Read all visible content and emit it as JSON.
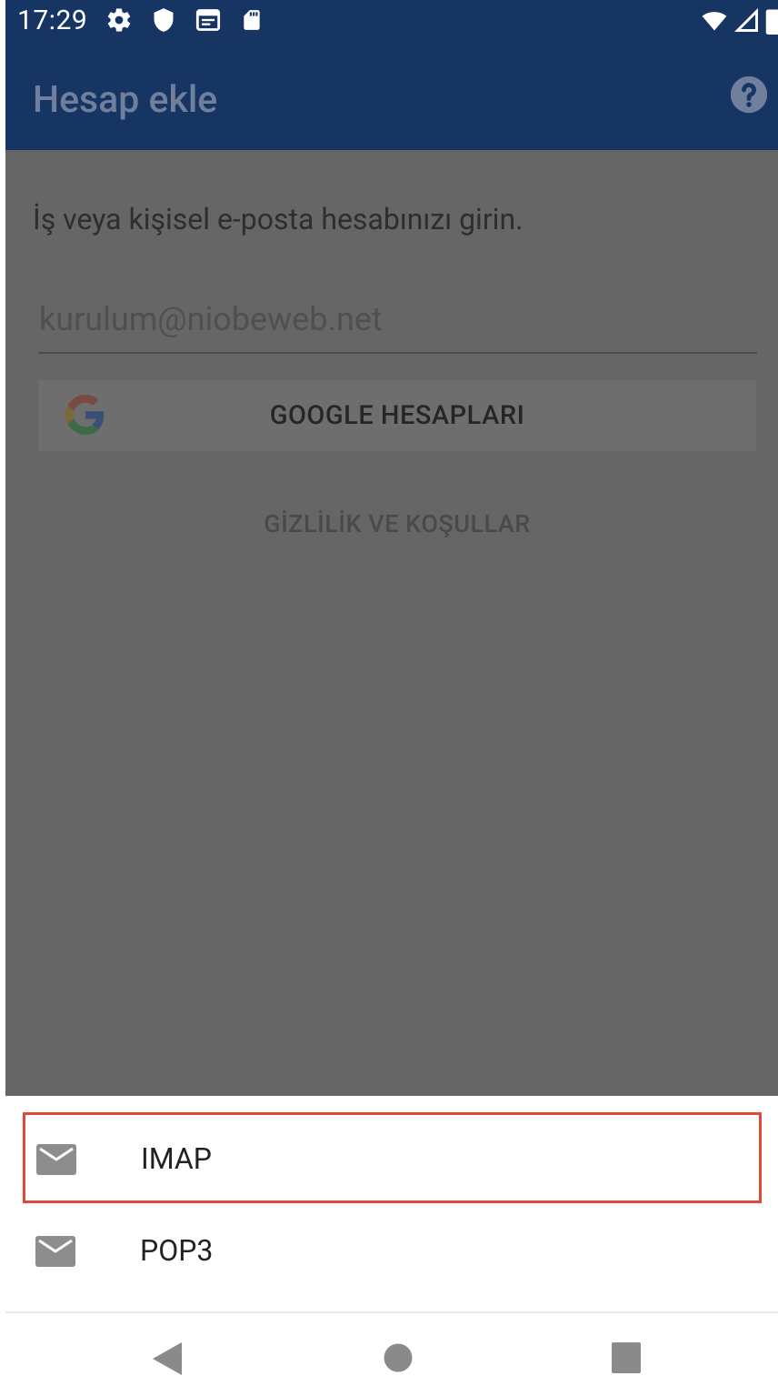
{
  "status_bar": {
    "time": "17:29",
    "icons_left": [
      "gear-icon",
      "shield-icon",
      "calendar-icon",
      "sd-card-icon"
    ],
    "icons_right": [
      "wifi-icon",
      "signal-icon",
      "battery-icon"
    ]
  },
  "app_bar": {
    "title": "Hesap ekle",
    "help_icon": "help-icon"
  },
  "main": {
    "instruction": "İş veya kişisel e-posta hesabınızı girin.",
    "email_placeholder": "kurulum@niobeweb.net",
    "google_button_label": "GOOGLE HESAPLARI",
    "privacy_link_label": "GİZLİLİK VE KOŞULLAR"
  },
  "bottom_sheet": {
    "items": [
      {
        "label": "IMAP",
        "icon": "mail-icon",
        "highlighted": true
      },
      {
        "label": "POP3",
        "icon": "mail-icon",
        "highlighted": false
      }
    ]
  },
  "nav_bar": {
    "buttons": [
      "back-icon",
      "home-icon",
      "recents-icon"
    ]
  },
  "colors": {
    "app_bar_bg": "#173563",
    "overlay_bg": "#666666",
    "highlight_border": "#e0483b"
  }
}
